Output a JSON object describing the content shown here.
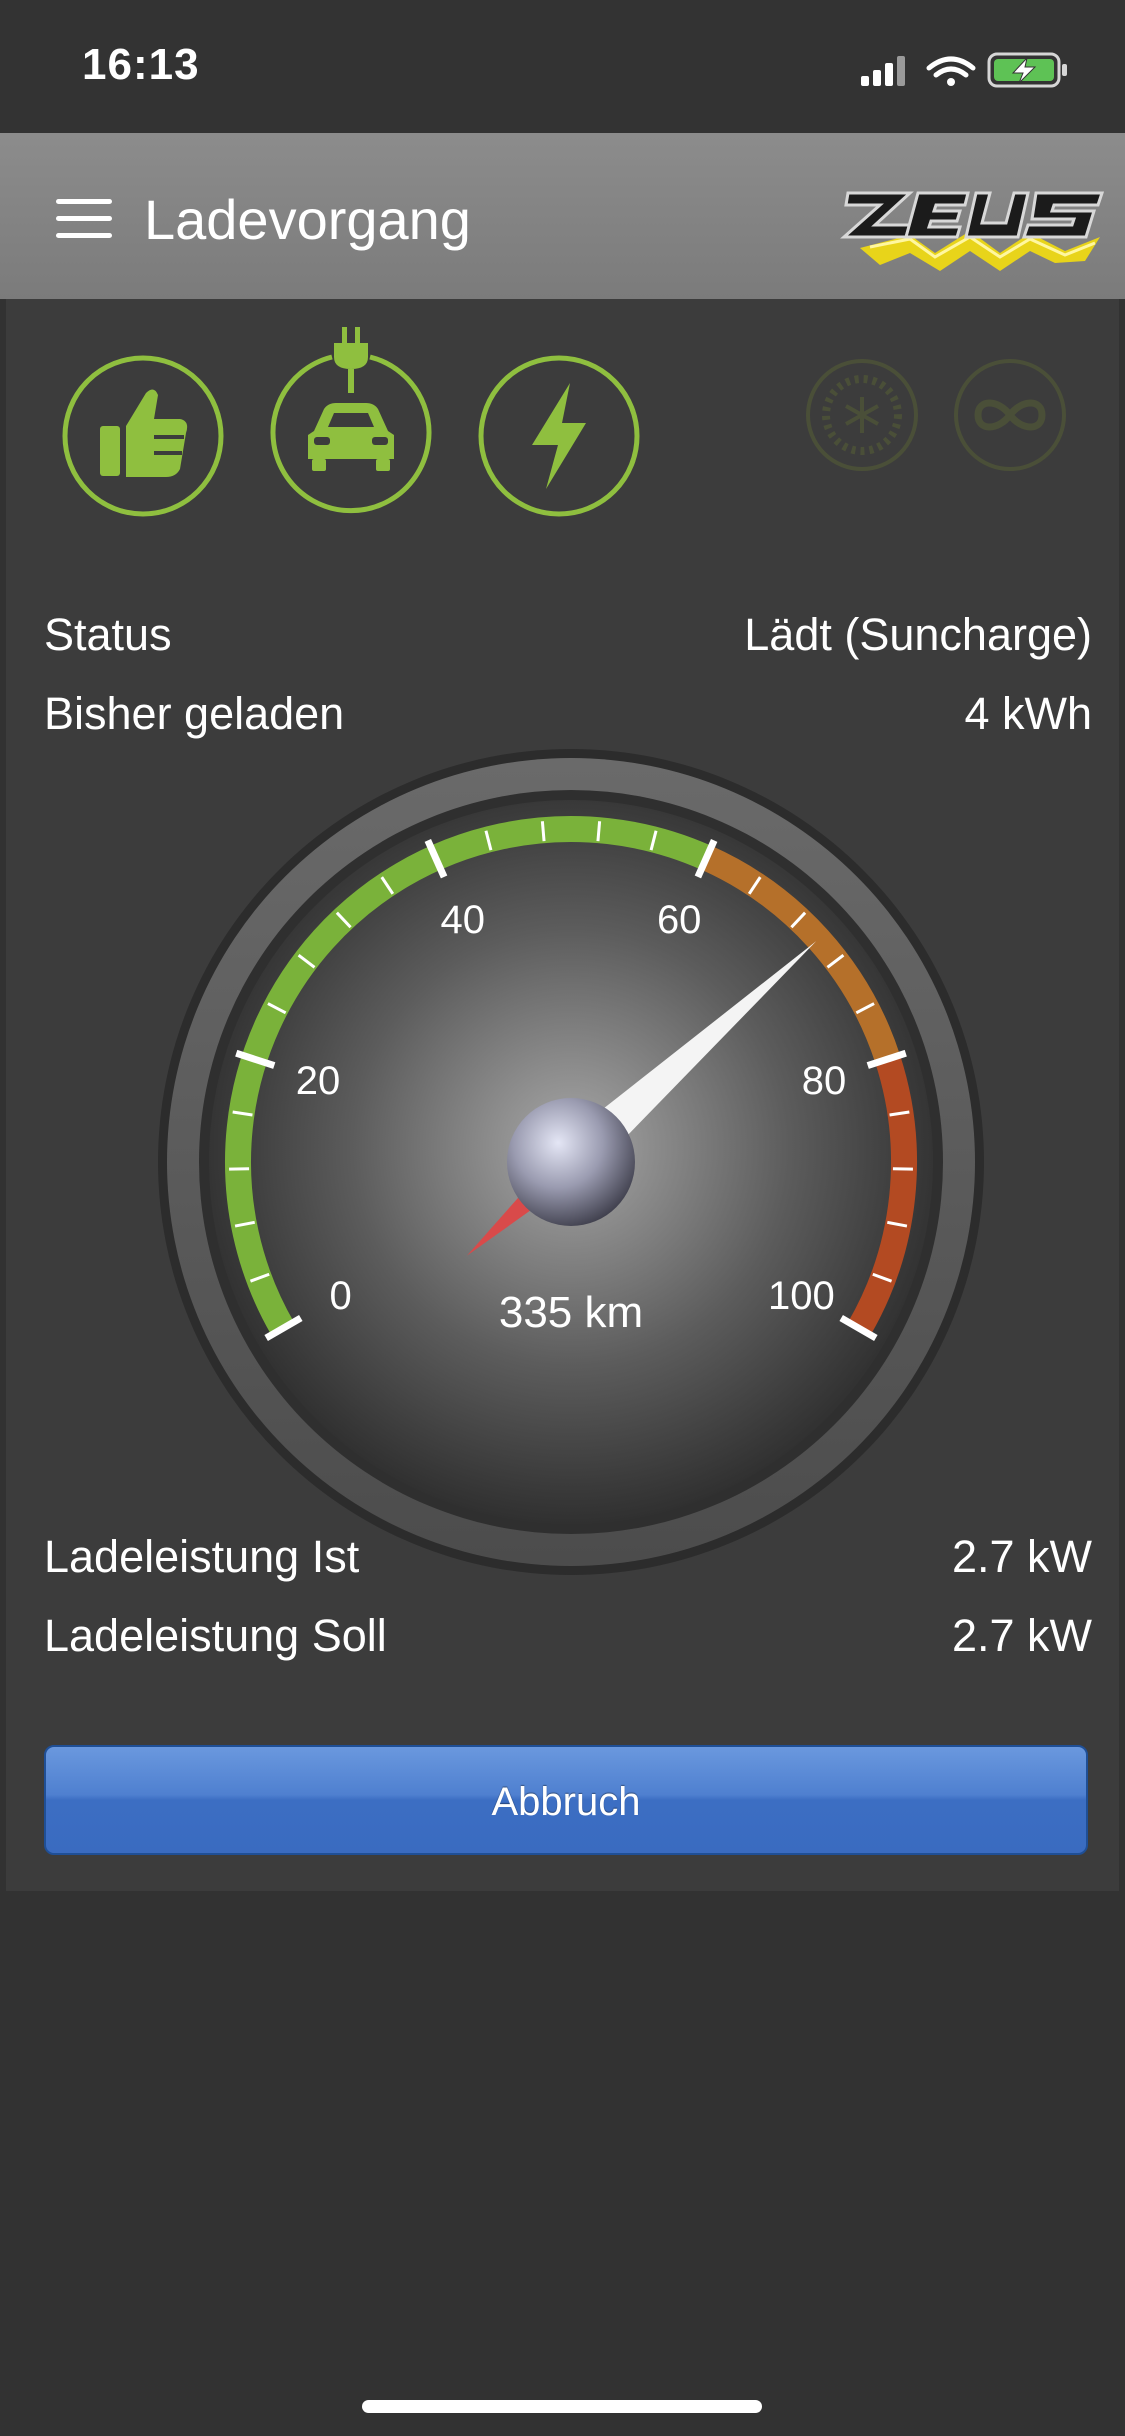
{
  "status_bar": {
    "time": "16:13"
  },
  "header": {
    "title": "Ladevorgang",
    "logo_icon": "zeus-logo"
  },
  "mode_icons": [
    {
      "name": "thumbs-up-icon",
      "active": true
    },
    {
      "name": "car-plug-icon",
      "active": true
    },
    {
      "name": "lightning-icon",
      "active": true
    },
    {
      "name": "snowflake-timer-icon",
      "active": false
    },
    {
      "name": "infinity-icon",
      "active": false
    }
  ],
  "info_top": [
    {
      "label": "Status",
      "value": "Lädt (Suncharge)"
    },
    {
      "label": "Bisher geladen",
      "value": "4 kWh"
    }
  ],
  "gauge": {
    "tick_labels": [
      "0",
      "20",
      "40",
      "60",
      "80",
      "100"
    ],
    "min": 0,
    "max": 100,
    "value": 70,
    "readout": "335 km",
    "bands": [
      {
        "from": 0,
        "to": 60,
        "color": "#7ab23a"
      },
      {
        "from": 60,
        "to": 80,
        "color": "#b5702a"
      },
      {
        "from": 80,
        "to": 100,
        "color": "#b34a22"
      }
    ]
  },
  "info_bottom": [
    {
      "label": "Ladeleistung Ist",
      "value": "2.7 kW"
    },
    {
      "label": "Ladeleistung Soll",
      "value": "2.7 kW"
    }
  ],
  "abort_button": {
    "label": "Abbruch"
  },
  "colors": {
    "accent_green": "#8fbf3f",
    "button_blue": "#3f72c4"
  }
}
